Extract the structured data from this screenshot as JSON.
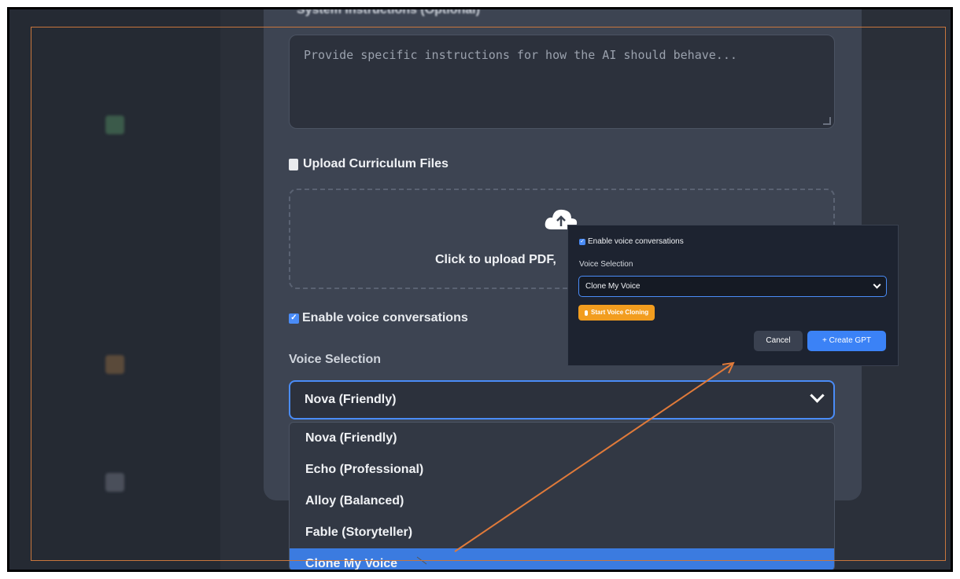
{
  "form": {
    "system_instructions_label": "System Instructions (Optional)",
    "system_instructions_placeholder": "Provide specific instructions for how the AI should behave...",
    "upload_title": "Upload Curriculum Files",
    "upload_hint": "Click to upload PDF,",
    "voice_toggle_label": "Enable voice conversations",
    "voice_selection_label": "Voice Selection",
    "voice_selected": "Nova (Friendly)",
    "voice_options": [
      "Nova (Friendly)",
      "Echo (Professional)",
      "Alloy (Balanced)",
      "Fable (Storyteller)",
      "Clone My Voice"
    ]
  },
  "zoom_panel": {
    "voice_toggle_label": "Enable voice conversations",
    "voice_selection_label": "Voice Selection",
    "voice_selected": "Clone My Voice",
    "clone_button": "Start Voice Cloning",
    "cancel_button": "Cancel",
    "create_button": "+ Create GPT"
  },
  "colors": {
    "accent": "#4a8cf7",
    "clone_orange": "#f29d1f",
    "annotation": "#e07a3a"
  }
}
